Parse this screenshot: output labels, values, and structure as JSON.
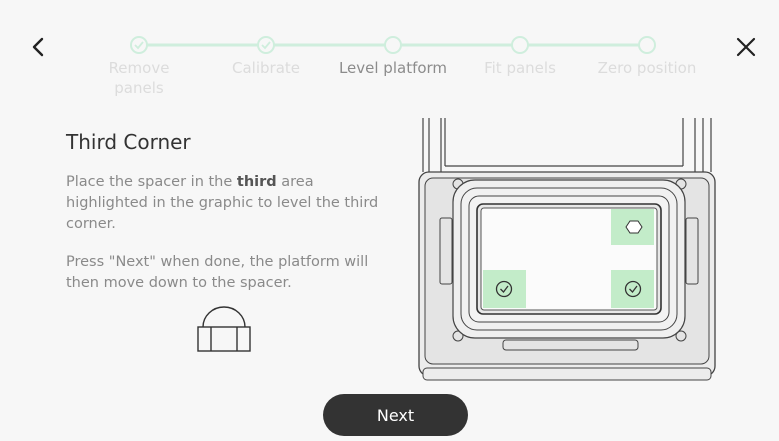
{
  "steps": [
    {
      "label_line1": "Remove",
      "label_line2": "panels",
      "state": "done"
    },
    {
      "label_line1": "Calibrate",
      "label_line2": "",
      "state": "done"
    },
    {
      "label_line1": "Level platform",
      "label_line2": "",
      "state": "current"
    },
    {
      "label_line1": "Fit panels",
      "label_line2": "",
      "state": "pending"
    },
    {
      "label_line1": "Zero position",
      "label_line2": "",
      "state": "pending"
    }
  ],
  "content": {
    "title": "Third Corner",
    "para1_before": "Place the spacer in the ",
    "para1_bold": "third",
    "para1_after": " area highlighted in the graphic to level the third corner.",
    "para2": "Press \"Next\" when done, the platform will then move down to the spacer."
  },
  "corners": [
    {
      "position": "top-right",
      "state": "active",
      "icon": "hexagon-icon"
    },
    {
      "position": "bottom-left",
      "state": "done",
      "icon": "check-circle-icon"
    },
    {
      "position": "bottom-right",
      "state": "done",
      "icon": "check-circle-icon"
    }
  ],
  "buttons": {
    "next_label": "Next"
  },
  "colors": {
    "accent": "#c6ecce",
    "stepper_line": "#cfeedd",
    "button_bg": "#333333",
    "highlight_green": "#c3ecc9"
  }
}
